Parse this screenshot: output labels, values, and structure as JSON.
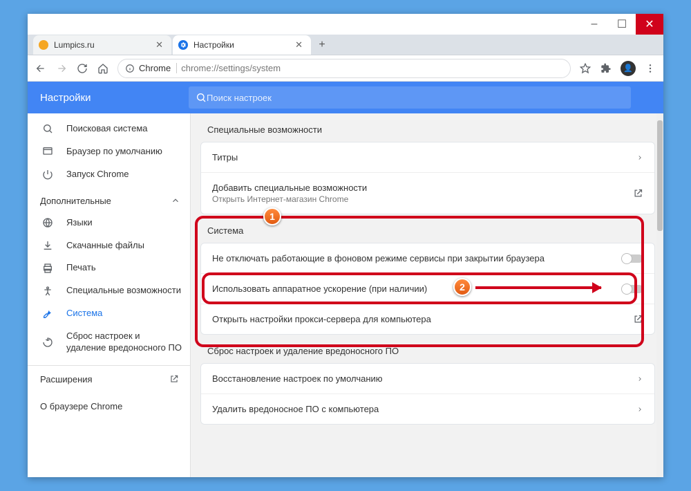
{
  "window": {
    "min": "–",
    "max": "☐",
    "close": "✕"
  },
  "tabs": [
    {
      "title": "Lumpics.ru",
      "favicon": "#f5a623"
    },
    {
      "title": "Настройки",
      "favicon": "#1a73e8"
    }
  ],
  "newtab": "+",
  "nav": {
    "origin_label": "Chrome",
    "url_path": "chrome://settings/system"
  },
  "header": {
    "title": "Настройки",
    "search_placeholder": "Поиск настроек"
  },
  "sidebar": {
    "items": [
      {
        "icon": "search",
        "label": "Поисковая система"
      },
      {
        "icon": "browser",
        "label": "Браузер по умолчанию"
      },
      {
        "icon": "power",
        "label": "Запуск Chrome"
      }
    ],
    "advanced_label": "Дополнительные",
    "advanced_items": [
      {
        "icon": "globe",
        "label": "Языки"
      },
      {
        "icon": "download",
        "label": "Скачанные файлы"
      },
      {
        "icon": "print",
        "label": "Печать"
      },
      {
        "icon": "a11y",
        "label": "Специальные возможности"
      },
      {
        "icon": "wrench",
        "label": "Система",
        "active": true
      },
      {
        "icon": "reset",
        "label": "Сброс настроек и удаление вредоносного ПО"
      }
    ],
    "extensions_label": "Расширения",
    "about_label": "О браузере Chrome"
  },
  "sections": {
    "a11y": {
      "title": "Специальные возможности",
      "rows": [
        {
          "label": "Титры",
          "action": "chevron"
        },
        {
          "label": "Добавить специальные возможности",
          "sub": "Открыть Интернет-магазин Chrome",
          "action": "open"
        }
      ]
    },
    "system": {
      "title": "Система",
      "rows": [
        {
          "label": "Не отключать работающие в фоновом режиме сервисы при закрытии браузера",
          "action": "toggle"
        },
        {
          "label": "Использовать аппаратное ускорение (при наличии)",
          "action": "toggle"
        },
        {
          "label": "Открыть настройки прокси-сервера для компьютера",
          "action": "open"
        }
      ]
    },
    "reset": {
      "title": "Сброс настроек и удаление вредоносного ПО",
      "rows": [
        {
          "label": "Восстановление настроек по умолчанию",
          "action": "chevron"
        },
        {
          "label": "Удалить вредоносное ПО с компьютера",
          "action": "chevron"
        }
      ]
    }
  },
  "callouts": {
    "1": "1",
    "2": "2"
  }
}
